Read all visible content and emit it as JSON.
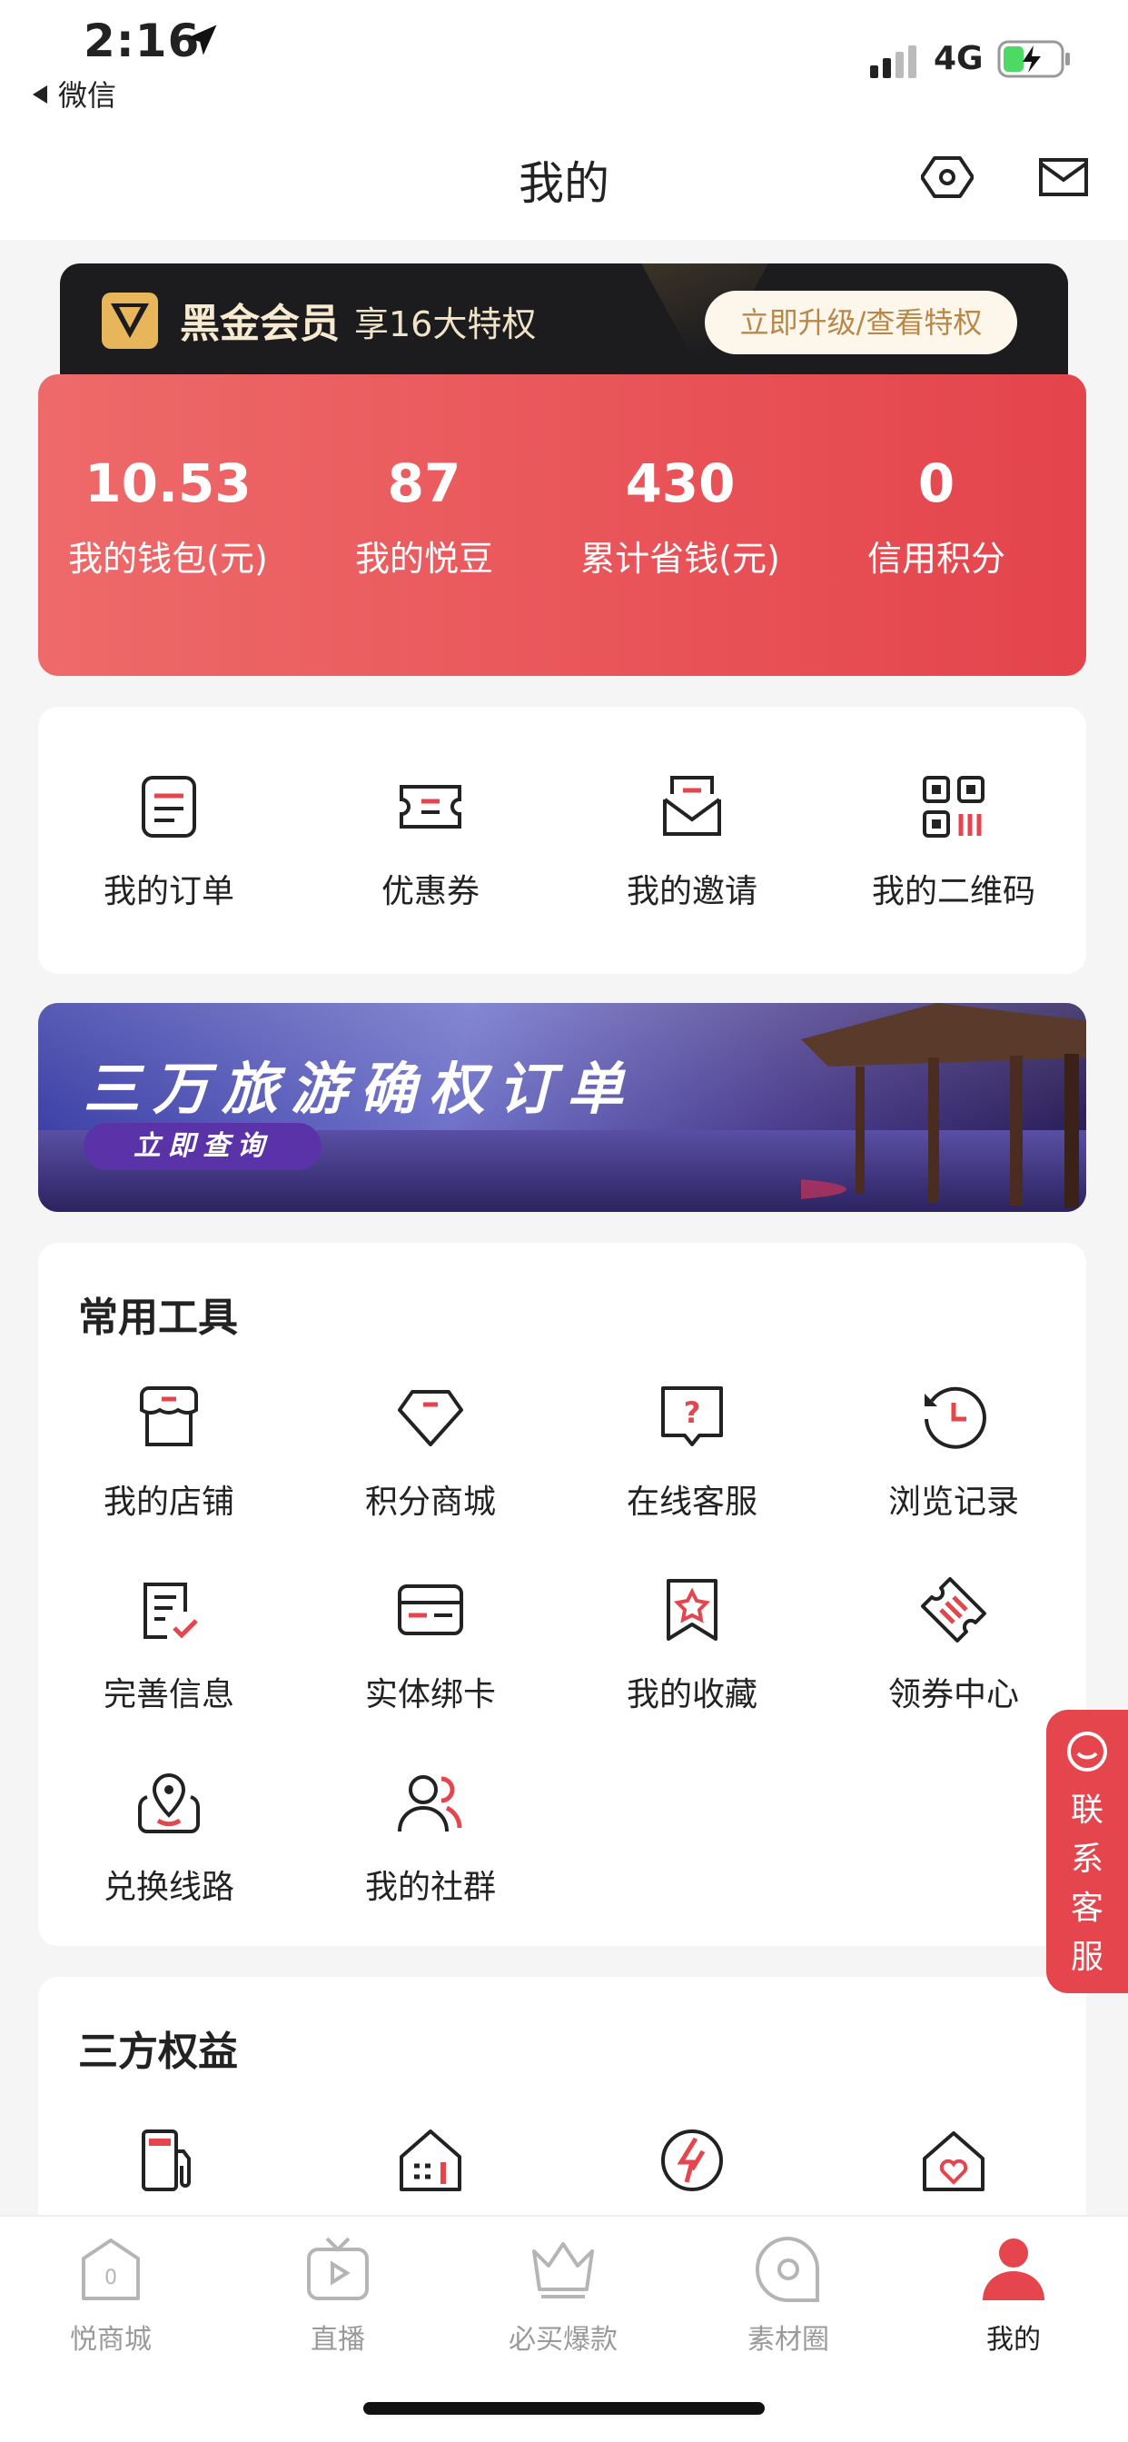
{
  "status_bar": {
    "time": "2:16",
    "back_app": "微信",
    "network": "4G"
  },
  "header": {
    "title": "我的"
  },
  "member": {
    "name": "黑金会员",
    "subtitle": "享16大特权",
    "button": "立即升级/查看特权"
  },
  "stats": [
    {
      "value": "10.53",
      "label": "我的钱包(元)"
    },
    {
      "value": "87",
      "label": "我的悦豆"
    },
    {
      "value": "430",
      "label": "累计省钱(元)"
    },
    {
      "value": "0",
      "label": "信用积分"
    }
  ],
  "quick": [
    {
      "label": "我的订单",
      "icon": "order-icon"
    },
    {
      "label": "优惠券",
      "icon": "coupon-icon"
    },
    {
      "label": "我的邀请",
      "icon": "invite-icon"
    },
    {
      "label": "我的二维码",
      "icon": "qrcode-icon"
    }
  ],
  "promo": {
    "title": "三万旅游确权订单",
    "button": "立即查询"
  },
  "tools": {
    "title": "常用工具",
    "items": [
      {
        "label": "我的店铺",
        "icon": "store-icon"
      },
      {
        "label": "积分商城",
        "icon": "diamond-icon"
      },
      {
        "label": "在线客服",
        "icon": "help-chat-icon"
      },
      {
        "label": "浏览记录",
        "icon": "history-icon"
      },
      {
        "label": "完善信息",
        "icon": "edit-info-icon"
      },
      {
        "label": "实体绑卡",
        "icon": "card-icon"
      },
      {
        "label": "我的收藏",
        "icon": "bookmark-star-icon"
      },
      {
        "label": "领券中心",
        "icon": "ticket-icon"
      },
      {
        "label": "兑换线路",
        "icon": "location-icon"
      },
      {
        "label": "我的社群",
        "icon": "group-icon"
      }
    ]
  },
  "rights": {
    "title": "三方权益",
    "items": [
      {
        "icon": "fuel-pump-icon"
      },
      {
        "icon": "building-icon"
      },
      {
        "icon": "lightning-icon"
      },
      {
        "icon": "heart-house-icon"
      }
    ]
  },
  "float_service": {
    "label": [
      "联",
      "系",
      "客",
      "服"
    ]
  },
  "tabbar": [
    {
      "label": "悦商城",
      "icon": "shop-home-icon",
      "active": false
    },
    {
      "label": "直播",
      "icon": "live-icon",
      "active": false
    },
    {
      "label": "必买爆款",
      "icon": "crown-icon",
      "active": false
    },
    {
      "label": "素材圈",
      "icon": "material-icon",
      "active": false
    },
    {
      "label": "我的",
      "icon": "profile-icon",
      "active": true
    }
  ],
  "colors": {
    "accent": "#e5454c",
    "gold": "#e7b55a",
    "member_bg": "#1c1c1f"
  }
}
